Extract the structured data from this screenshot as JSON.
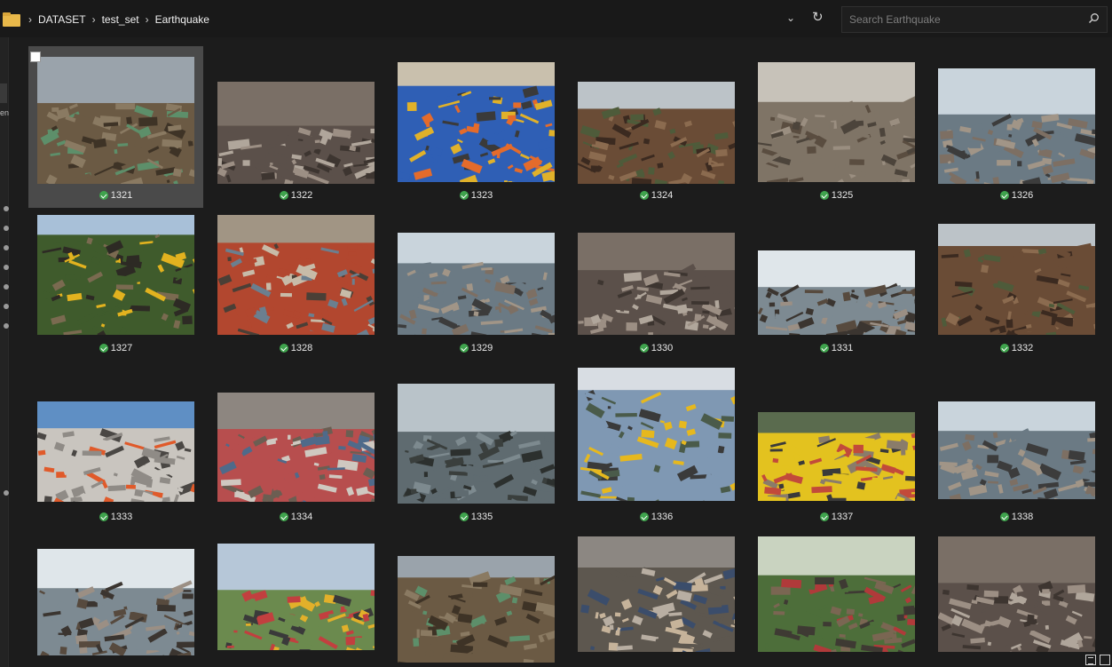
{
  "breadcrumb": {
    "folder_icon": "folder-icon",
    "items": [
      "DATASET",
      "test_set",
      "Earthquake"
    ],
    "separator": "›"
  },
  "toolbar": {
    "dropdown_icon": "chevron-down-icon",
    "refresh_icon": "refresh-icon",
    "chevron": "⌄",
    "refresh": "↻"
  },
  "search": {
    "placeholder": "Search Earthquake",
    "icon": "search-icon"
  },
  "left_pane": {
    "label": "en"
  },
  "colors": {
    "background": "#1c1c1c",
    "selection": "#4a4a4a",
    "status_ok": "#3fa34d",
    "folder": "#e8b84a"
  },
  "files": [
    {
      "name": "1321",
      "status": "synced",
      "selected": true,
      "theme": "ruins-house"
    },
    {
      "name": "1322",
      "status": "synced",
      "selected": false,
      "theme": "debris"
    },
    {
      "name": "1323",
      "status": "synced",
      "selected": false,
      "theme": "tarps"
    },
    {
      "name": "1324",
      "status": "synced",
      "selected": false,
      "theme": "wood-pile"
    },
    {
      "name": "1325",
      "status": "synced",
      "selected": false,
      "theme": "flood-ruins"
    },
    {
      "name": "1326",
      "status": "synced",
      "selected": false,
      "theme": "street"
    },
    {
      "name": "1327",
      "status": "synced",
      "selected": false,
      "theme": "excavator"
    },
    {
      "name": "1328",
      "status": "synced",
      "selected": false,
      "theme": "roofs"
    },
    {
      "name": "1329",
      "status": "synced",
      "selected": false,
      "theme": "street"
    },
    {
      "name": "1330",
      "status": "synced",
      "selected": false,
      "theme": "debris"
    },
    {
      "name": "1331",
      "status": "synced",
      "selected": false,
      "theme": "flattened"
    },
    {
      "name": "1332",
      "status": "synced",
      "selected": false,
      "theme": "wood-pile"
    },
    {
      "name": "1333",
      "status": "synced",
      "selected": false,
      "theme": "concrete"
    },
    {
      "name": "1334",
      "status": "synced",
      "selected": false,
      "theme": "aerial"
    },
    {
      "name": "1335",
      "status": "synced",
      "selected": false,
      "theme": "coast"
    },
    {
      "name": "1336",
      "status": "synced",
      "selected": false,
      "theme": "bridge"
    },
    {
      "name": "1337",
      "status": "synced",
      "selected": false,
      "theme": "bags"
    },
    {
      "name": "1338",
      "status": "synced",
      "selected": false,
      "theme": "street"
    },
    {
      "name": "",
      "status": "",
      "selected": false,
      "theme": "flattened"
    },
    {
      "name": "",
      "status": "",
      "selected": false,
      "theme": "crowd"
    },
    {
      "name": "",
      "status": "",
      "selected": false,
      "theme": "ruins-house"
    },
    {
      "name": "",
      "status": "",
      "selected": false,
      "theme": "boy-rubble"
    },
    {
      "name": "",
      "status": "",
      "selected": false,
      "theme": "palms"
    },
    {
      "name": "",
      "status": "",
      "selected": false,
      "theme": "debris"
    }
  ],
  "view_toggle": {
    "details_icon": "details-view-icon",
    "tiles_icon": "large-icons-view-icon"
  }
}
